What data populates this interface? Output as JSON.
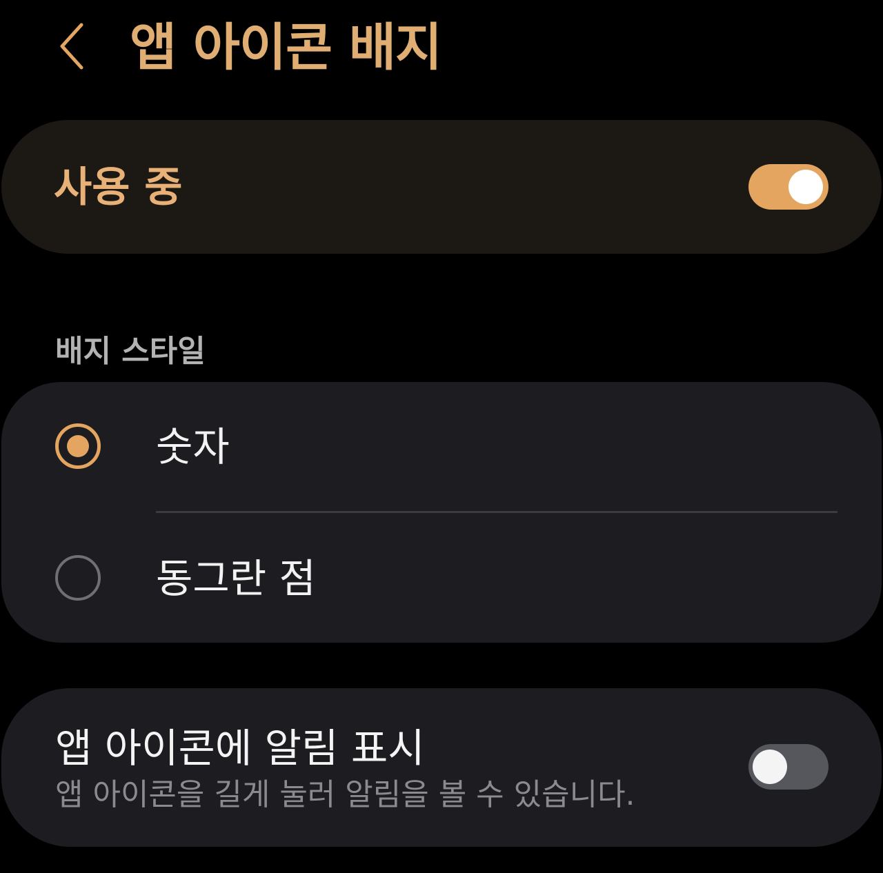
{
  "header": {
    "back_icon": "chevron-left-icon",
    "title": "앱 아이콘 배지"
  },
  "master_switch": {
    "label": "사용 중",
    "enabled": true
  },
  "badge_style": {
    "section_title": "배지 스타일",
    "options": [
      {
        "label": "숫자",
        "selected": true
      },
      {
        "label": "동그란 점",
        "selected": false
      }
    ]
  },
  "show_notifications": {
    "title": "앱 아이콘에 알림 표시",
    "description": "앱 아이콘을 길게 눌러 알림을 볼 수 있습니다.",
    "enabled": false
  },
  "colors": {
    "background": "#000000",
    "accent": "#e3a55f",
    "title_text": "#e0ad72",
    "card_master": "#1c1813",
    "card": "#1d1d21",
    "toggle_off_track": "#55575c"
  }
}
